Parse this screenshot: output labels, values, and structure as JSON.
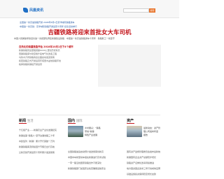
{
  "header": {
    "logo_text": "凤凰资讯",
    "search_placeholder": "",
    "search_button": "搜索"
  },
  "top_rows": [
    "全国第一条高速铁路开通 2008年8月1日京津城际铁路通车",
    "中国第一条高铁：京津城际铁路开通运营十周年 纪念活动举行"
  ],
  "headline": "吉疆铁路将迎来首批女大车司机",
  "sublinks": "中国人民解放军铁道兵第一支援部队奔赴新疆建设铁路 · 中国第一条高速铁路通车十周年 · 铁路职工一线坚守",
  "left_col": {
    "title": "白热化的南疆铁路开始 2018年10月1日下4个城市",
    "items": [
      "新疆铁路营运里程突破6000公里创历史新高",
      "南疆铁路库尔勒至喀什段电气化改造工程",
      "乌鲁木齐局铁路春运全面启动发送旅客",
      "和若铁路正式开通运营环塔里木盆地铁路环线",
      "格库铁路新疆段开通运营"
    ]
  },
  "sections": [
    {
      "title": "新闻",
      "en": "生活"
    },
    {
      "title": "国内",
      "en": "国际"
    },
    {
      "title": "资产",
      "en": ""
    }
  ],
  "col1": [
    "千亿级产业——新疆农业产业化发展纪实",
    "新疆最美“铁路人”坚守边疆线路三十年",
    "中欧班列（新疆）累计开行突破一万列",
    "新疆铁路客流持续回升节假日出行高峰",
    "兰新高铁开通运营十周年累计发送旅客"
  ],
  "col2_caption": [
    "乡村振兴：“铁路",
    "带动”新疆",
    "特色产业发展"
  ],
  "col2": [
    "全国铁路暑运启动预计发送旅客创新高",
    "中国中车新型动车组在新疆进行高寒试验",
    "一带一路沿线国家铁路合作不断深化",
    "新疆铁路部门加强安全检查确保运输安全"
  ],
  "col3_caption": [
    "最新动态：资产管",
    "理公司发布年度",
    "报告"
  ],
  "col3": [
    "国有资产监督管理委员会发布最新统计数据",
    "新疆国有企业资产总额稳步增长",
    "铁路资产证券化改革持续推进",
    "地方国资国企改革三年行动成效显著",
    "基础设施投资保持稳定增长态势"
  ]
}
